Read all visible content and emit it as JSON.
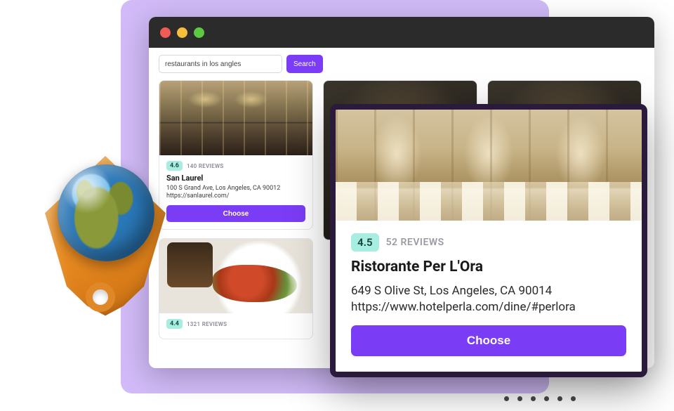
{
  "search": {
    "value": "restaurants in los angles",
    "button_label": "Search"
  },
  "results": [
    {
      "rating": "4.6",
      "reviews": "140 REVIEWS",
      "title": "San Laurel",
      "address": "100 S Grand Ave, Los Angeles, CA 90012",
      "url": "https://sanlaurel.com/",
      "choose": "Choose"
    },
    {
      "rating": "4.4",
      "reviews": "1321 REVIEWS"
    }
  ],
  "featured": {
    "rating": "4.5",
    "reviews": "52 REVIEWS",
    "title": "Ristorante Per L'Ora",
    "address": "649 S Olive St, Los Angeles, CA 90014",
    "url": "https://www.hotelperla.com/dine/#perlora",
    "choose": "Choose"
  }
}
